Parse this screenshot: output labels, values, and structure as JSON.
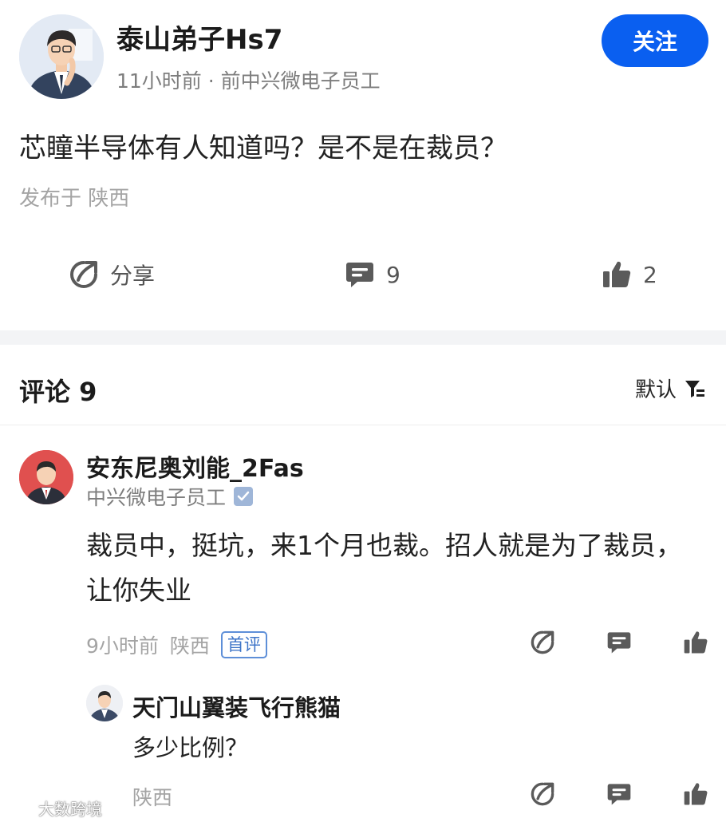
{
  "post": {
    "author": "泰山弟子Hs7",
    "meta": "11小时前 · 前中兴微电子员工",
    "follow_label": "关注",
    "body": "芯瞳半导体有人知道吗？是不是在裁员？",
    "location": "发布于 陕西",
    "actions": {
      "share_label": "分享",
      "comment_count": "9",
      "like_count": "2"
    }
  },
  "comments_section": {
    "title": "评论 9",
    "sort_label": "默认"
  },
  "comment": {
    "author": "安东尼奥刘能_2Fas",
    "role": "中兴微电子员工",
    "text": "裁员中，挺坑，来1个月也裁。招人就是为了裁员，让你失业",
    "time": "9小时前",
    "location": "陕西",
    "badge": "首评"
  },
  "reply": {
    "author": "天门山翼装飞行熊猫",
    "text": "多少比例？",
    "location": "陕西"
  },
  "watermark": "大数跨境",
  "colors": {
    "accent": "#0a5ff0",
    "icon": "#5a5a5a",
    "muted": "#a4a4a4"
  }
}
